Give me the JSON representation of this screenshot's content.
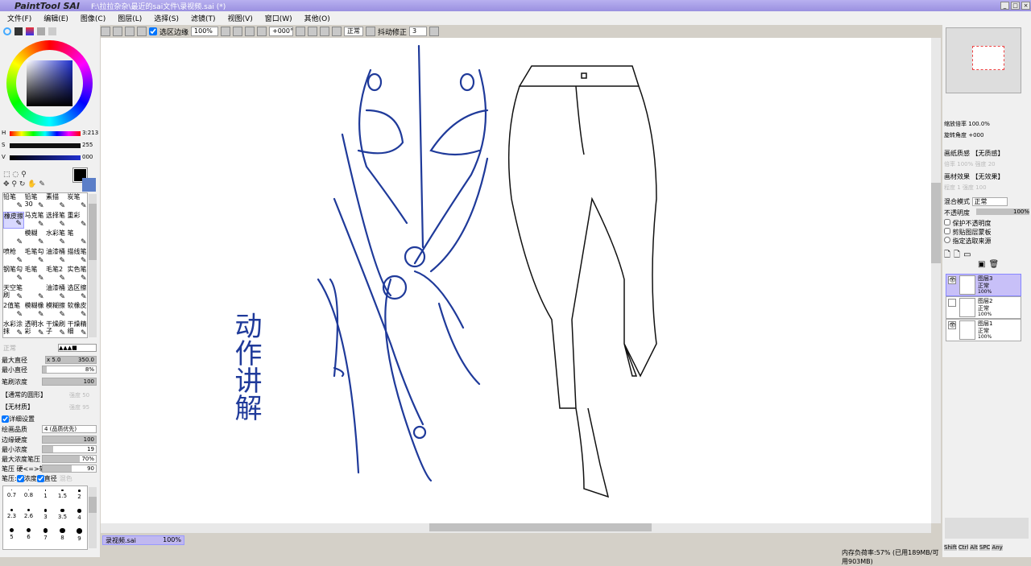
{
  "window": {
    "app_name": "PaintTool SAI",
    "path": "F:\\拉拉杂杂\\最近的sai文件\\录视频.sai (*)",
    "min": "_",
    "max": "□",
    "close": "×"
  },
  "menu": [
    "文件(F)",
    "编辑(E)",
    "图像(C)",
    "图层(L)",
    "选择(S)",
    "滤镜(T)",
    "视图(V)",
    "窗口(W)",
    "其他(O)"
  ],
  "toolbar": {
    "selection_edge_label": "选区边缘",
    "selection_edge_checked": true,
    "zoom": "100%",
    "rotation": "+000°",
    "blend": "正常",
    "stabilizer_label": "抖动修正",
    "stabilizer_value": "3"
  },
  "color": {
    "h_label": "H",
    "h_value": "3:213",
    "s_label": "S",
    "s_value": "255",
    "v_label": "V",
    "v_value": "000",
    "fg": "#000000",
    "bg": "#5b7ec8"
  },
  "brushes": [
    [
      "铅笔",
      "铅笔30",
      "素描",
      "炭笔"
    ],
    [
      "橡皮擦",
      "马克笔",
      "选择笔",
      "重彩"
    ],
    [
      "",
      "模糊",
      "水彩笔",
      "笔"
    ],
    [
      "喷枪",
      "毛笔勾",
      "油漆桶",
      "描线笔"
    ],
    [
      "钢笔勾",
      "毛笔",
      "毛笔2",
      "实色笔"
    ],
    [
      "天空笔刷",
      "",
      "油漆桶",
      "选区擦"
    ],
    [
      "2值笔",
      "模糊橡",
      "模糊擦",
      "软橡皮"
    ],
    [
      "水彩涂抹",
      "透明水彩",
      "干燥刷子",
      "干燥精细"
    ]
  ],
  "brush_settings": {
    "mode": "正常",
    "max_size_label": "最大直径",
    "max_size_mult": "x 5.0",
    "max_size": "350.0",
    "min_size_label": "最小直径",
    "min_size": "8%",
    "density_label": "笔刷浓度",
    "density": "100",
    "shape": "【通常的圆形】",
    "shape_strength": "强度 50",
    "texture": "【无材质】",
    "texture_strength": "强度 95",
    "detail_label": "详细设置",
    "quality_label": "绘画品质",
    "quality": "4 (品质优先)",
    "edge_label": "边缘硬度",
    "edge": "100",
    "min_density_label": "最小浓度",
    "min_density": "19",
    "max_pressure_label": "最大浓度笔压",
    "max_pressure": "70%",
    "hardness_label": "笔压 硬<=>软",
    "hardness": "90",
    "pressure_label": "笔压:",
    "p_density": "浓度",
    "p_size": "直径",
    "p_blend": "混色"
  },
  "sizes": [
    "0.7",
    "0.8",
    "1",
    "1.5",
    "2",
    "2.3",
    "2.6",
    "3",
    "3.5",
    "4",
    "5",
    "6",
    "7",
    "8",
    "9"
  ],
  "navigator": {
    "zoom_label": "缩放倍率",
    "zoom": "100.0%",
    "angle_label": "旋转角度",
    "angle": "+000"
  },
  "paper": {
    "label": "画纸质感",
    "value": "【无质感】",
    "s1": "倍率",
    "v1": "100%",
    "s2": "强度",
    "v2": "20"
  },
  "effect": {
    "label": "画材效果",
    "value": "【无效果】",
    "s1": "程度",
    "v1": "1",
    "s2": "强度",
    "v2": "100"
  },
  "layer_props": {
    "blend_label": "混合模式",
    "blend": "正常",
    "opacity_label": "不透明度",
    "opacity": "100%",
    "protect": "保护不透明度",
    "clip": "剪贴图层蒙板",
    "source": "指定选取来源"
  },
  "layers": [
    {
      "name": "图层3",
      "mode": "正常",
      "opacity": "100%",
      "visible": true,
      "selected": true
    },
    {
      "name": "图层2",
      "mode": "正常",
      "opacity": "100%",
      "visible": false,
      "selected": false
    },
    {
      "name": "图层1",
      "mode": "正常",
      "opacity": "100%",
      "visible": true,
      "selected": false
    }
  ],
  "doc_tab": {
    "name": "录视频.sai",
    "zoom": "100%"
  },
  "status": {
    "memory": "内存负荷率:57% (已用189MB/可用903MB)",
    "keys": [
      "Shift",
      "Ctrl",
      "Alt",
      "SPC",
      "Any"
    ]
  },
  "canvas_text": "动作讲解"
}
